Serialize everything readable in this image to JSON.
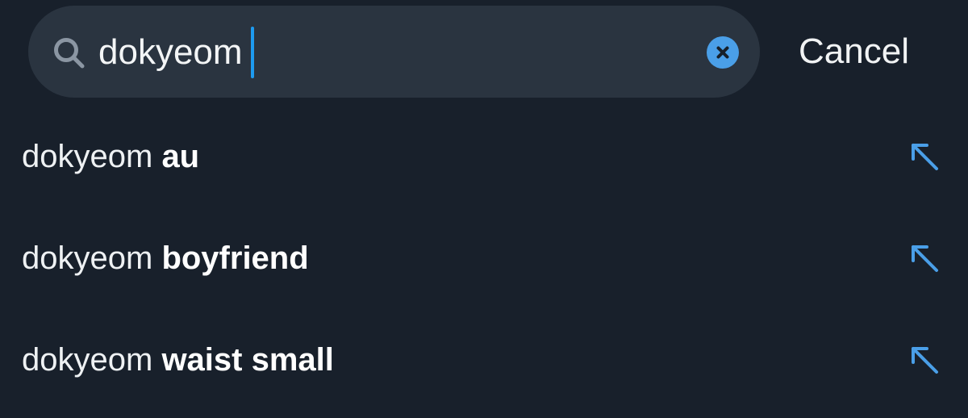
{
  "search": {
    "query": "dokyeom",
    "icon": "search-icon",
    "clear_icon": "close-icon"
  },
  "actions": {
    "cancel_label": "Cancel"
  },
  "suggestions": [
    {
      "prefix": "dokyeom",
      "completion": "au",
      "icon": "arrow-up-left-icon"
    },
    {
      "prefix": "dokyeom",
      "completion": "boyfriend",
      "icon": "arrow-up-left-icon"
    },
    {
      "prefix": "dokyeom",
      "completion": "waist small",
      "icon": "arrow-up-left-icon"
    }
  ],
  "colors": {
    "background": "#18202b",
    "search_field": "#2a3440",
    "accent": "#1d9bf0",
    "clear_button": "#4a9fe8",
    "text": "#eef1f3"
  }
}
